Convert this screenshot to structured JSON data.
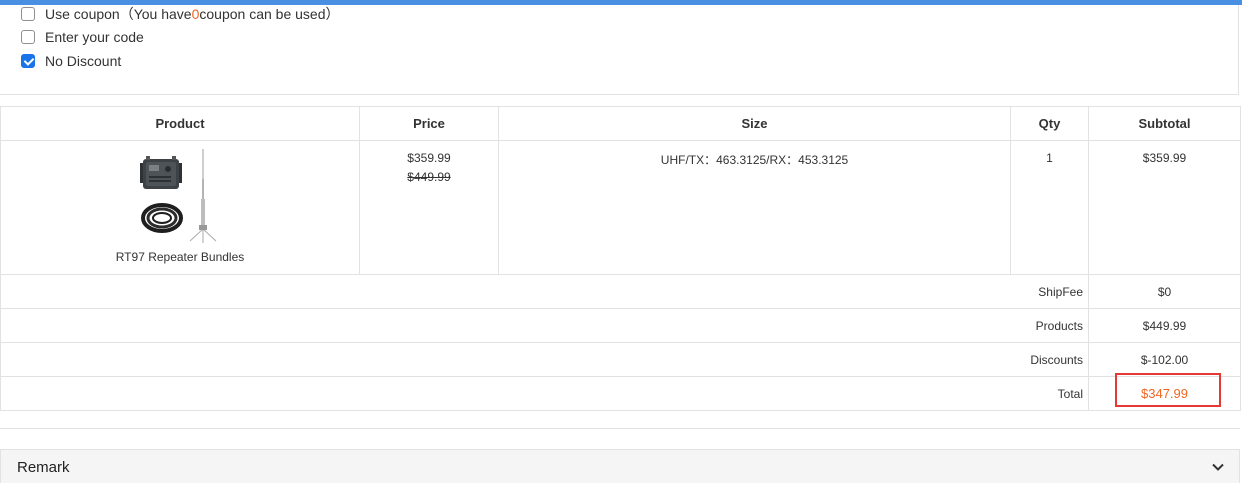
{
  "coupon": {
    "use_coupon_prefix": "Use coupon（You have",
    "use_coupon_count": "0",
    "use_coupon_suffix": "coupon can be used）",
    "enter_code_label": "Enter your code",
    "no_discount_label": "No Discount",
    "selected": "No Discount"
  },
  "table": {
    "headers": [
      "Product",
      "Price",
      "Size",
      "Qty",
      "Subtotal"
    ],
    "item": {
      "image_icon": "repeater-bundle-image",
      "name": "RT97 Repeater Bundles",
      "price": "$359.99",
      "original_price": "$449.99",
      "size": "UHF/TX：463.3125/RX：453.3125",
      "qty": "1",
      "subtotal": "$359.99"
    },
    "summary": {
      "shipfee_label": "ShipFee",
      "shipfee_value": "$0",
      "products_label": "Products",
      "products_value": "$449.99",
      "discounts_label": "Discounts",
      "discounts_value": "$-102.00",
      "total_label": "Total",
      "total_value": "$347.99"
    }
  },
  "remark": {
    "label": "Remark",
    "icon": "chevron-down-icon"
  },
  "colors": {
    "accent_bar": "#4a90e2",
    "checkbox_checked": "#1a73e8",
    "total_text": "#f26522",
    "highlight_border": "#e53935"
  }
}
